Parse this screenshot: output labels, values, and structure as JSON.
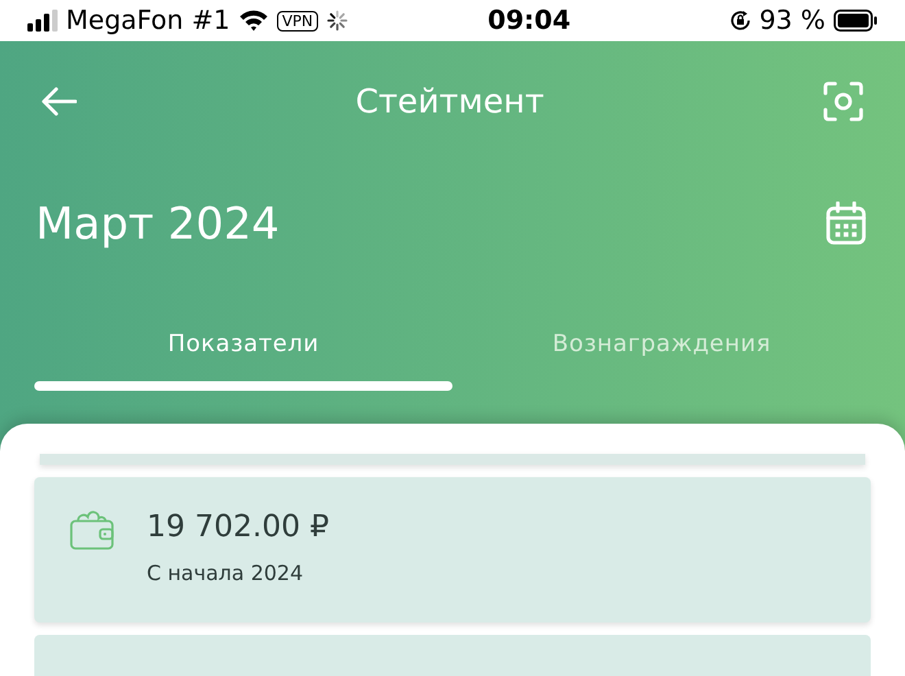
{
  "status_bar": {
    "carrier": "MegaFon #1",
    "vpn": "VPN",
    "time": "09:04",
    "battery": "93 %"
  },
  "header": {
    "title": "Стейтмент"
  },
  "period": {
    "label": "Март 2024"
  },
  "tabs": [
    {
      "label": "Показатели",
      "selected": true
    },
    {
      "label": "Вознаграждения",
      "selected": false
    }
  ],
  "cards": [
    {
      "amount": "19 702.00 ₽",
      "caption": "С начала 2024"
    }
  ]
}
